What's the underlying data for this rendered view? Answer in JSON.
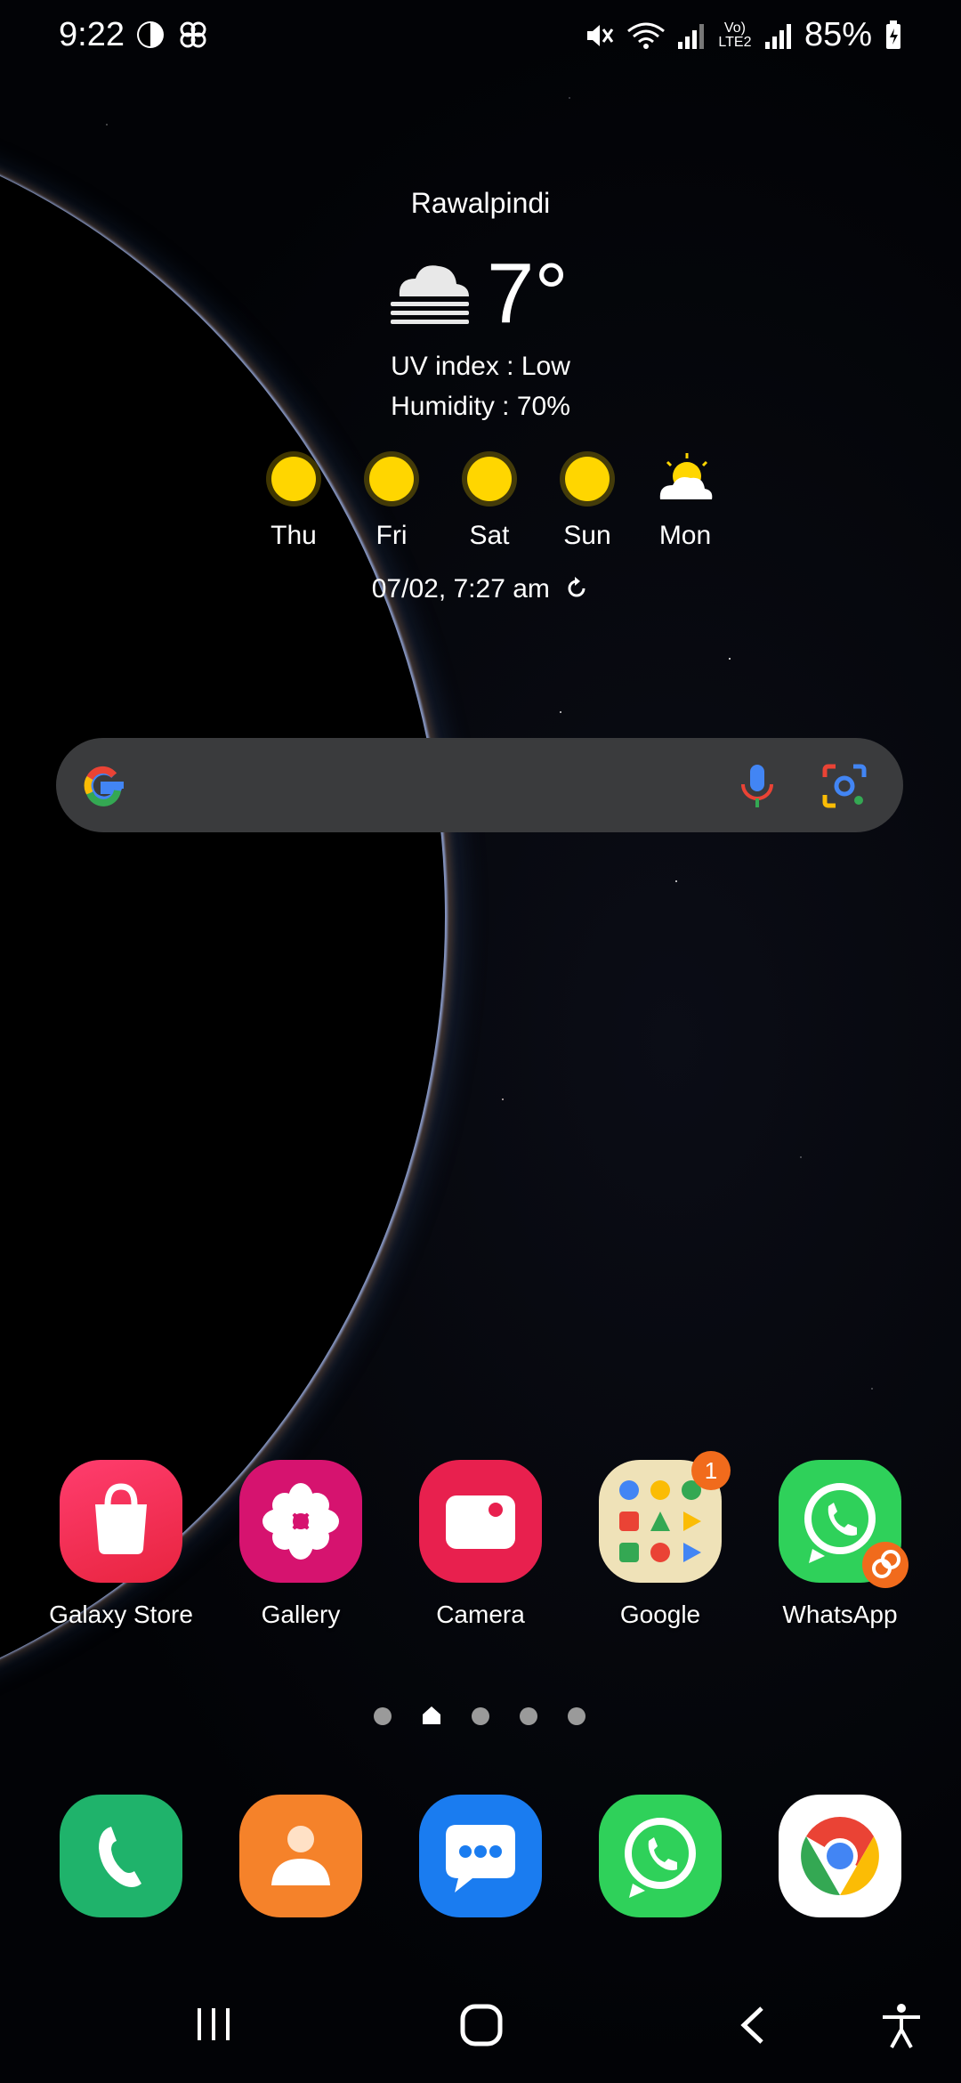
{
  "status_bar": {
    "time": "9:22",
    "battery": "85%",
    "network_label": "Vo) LTE2"
  },
  "weather": {
    "city": "Rawalpindi",
    "temperature": "7°",
    "condition_icon": "fog-cloud-icon",
    "uv": "UV index : Low",
    "humidity": "Humidity : 70%",
    "forecast": [
      {
        "day": "Thu",
        "icon": "sun-icon"
      },
      {
        "day": "Fri",
        "icon": "sun-icon"
      },
      {
        "day": "Sat",
        "icon": "sun-icon"
      },
      {
        "day": "Sun",
        "icon": "sun-icon"
      },
      {
        "day": "Mon",
        "icon": "partly-cloudy-icon"
      }
    ],
    "updated": "07/02, 7:27 am"
  },
  "home_apps": [
    {
      "label": "Galaxy Store",
      "color": "#e8284e"
    },
    {
      "label": "Gallery",
      "color": "#d6136f"
    },
    {
      "label": "Camera",
      "color": "#e8204e"
    },
    {
      "label": "Google",
      "color": "#efe2b8",
      "badge": "1"
    },
    {
      "label": "WhatsApp",
      "color": "#2fd15a"
    }
  ],
  "dock_apps": [
    {
      "name": "phone",
      "color": "#1fb36b"
    },
    {
      "name": "contacts",
      "color": "#f5822a"
    },
    {
      "name": "messages",
      "color": "#1a7cf0"
    },
    {
      "name": "whatsapp",
      "color": "#2fd15a"
    },
    {
      "name": "chrome",
      "color": "#ffffff"
    }
  ]
}
